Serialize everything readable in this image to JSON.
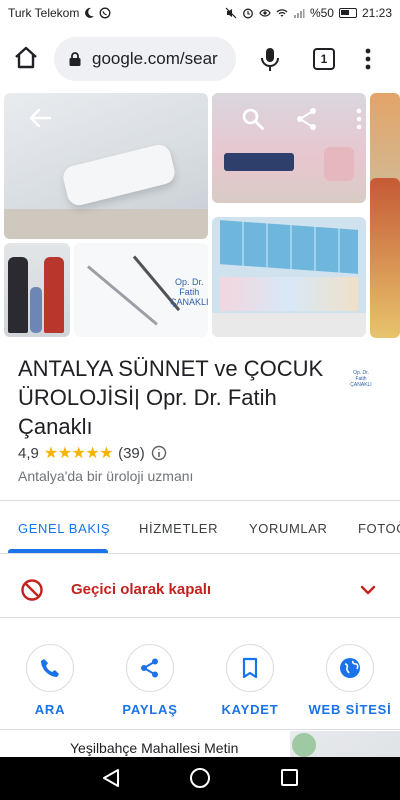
{
  "status_bar": {
    "carrier": "Turk Telekom",
    "battery": "%50",
    "time": "21:23"
  },
  "browser": {
    "url": "google.com/sear",
    "tab_count": "1",
    "icons": [
      "home-icon",
      "lock-icon",
      "mic-icon",
      "tabs-icon",
      "more-vert-icon"
    ]
  },
  "gallery": {
    "photo_logo_line1": "Op. Dr.",
    "photo_logo_line2": "Fatih",
    "photo_logo_line3": "ÇANAKLI",
    "icons": [
      "back-arrow-icon",
      "search-icon",
      "share-icon",
      "more-vert-icon"
    ]
  },
  "place": {
    "title": "ANTALYA SÜNNET ve ÇOCUK ÜROLOJİSİ| Opr. Dr. Fatih Çanaklı",
    "rating": "4,9",
    "stars": "★★★★★",
    "review_count": "(39)",
    "category": "Antalya'da bir üroloji uzmanı",
    "logo_line1": "Op. Dr.",
    "logo_line2": "Fatih",
    "logo_line3": "ÇANAKLI"
  },
  "tabs": [
    {
      "label": "GENEL BAKIŞ",
      "active": true
    },
    {
      "label": "HİZMETLER",
      "active": false
    },
    {
      "label": "YORUMLAR",
      "active": false
    },
    {
      "label": "FOTOĞ",
      "active": false
    }
  ],
  "status": {
    "text": "Geçici olarak kapalı",
    "color": "#c5221f"
  },
  "actions": [
    {
      "label": "ARA",
      "icon": "phone-icon"
    },
    {
      "label": "PAYLAŞ",
      "icon": "share-icon"
    },
    {
      "label": "KAYDET",
      "icon": "bookmark-icon"
    },
    {
      "label": "WEB SİTESİ",
      "icon": "globe-icon"
    }
  ],
  "address": "Yeşilbahçe Mahallesi Metin",
  "colors": {
    "accent": "#1a73e8",
    "star": "#f4b400",
    "closed": "#c5221f"
  }
}
